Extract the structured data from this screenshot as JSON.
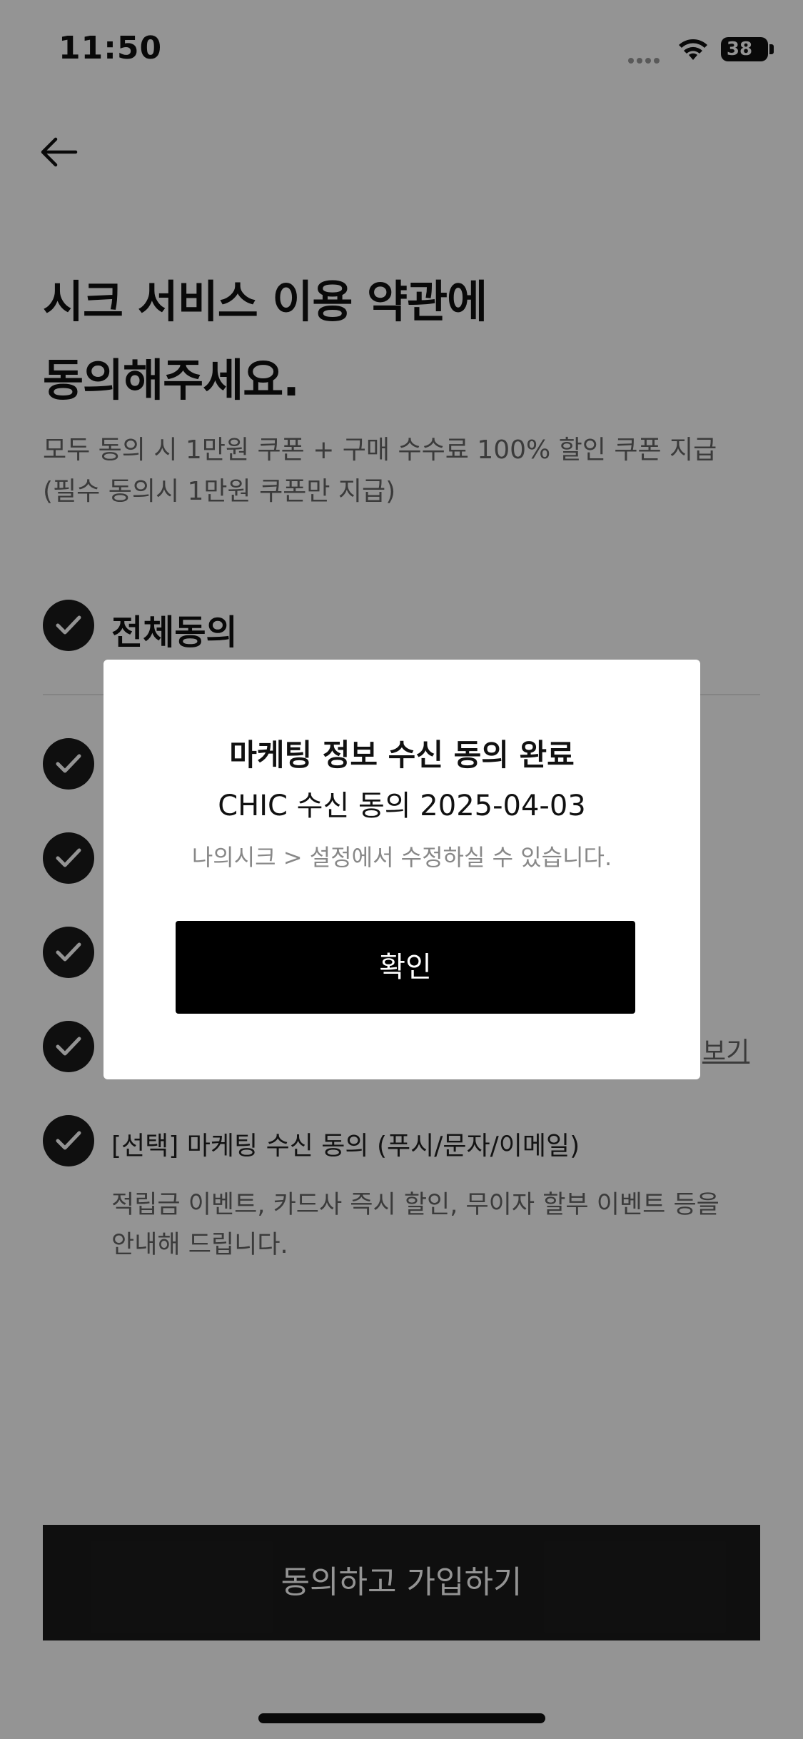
{
  "status_bar": {
    "time": "11:50",
    "battery": "38"
  },
  "header": {
    "back_icon": "arrow-left-icon"
  },
  "title_lines": [
    "시크 서비스 이용 약관에",
    "동의해주세요."
  ],
  "subtitle_lines": [
    "모두 동의 시 1만원 쿠폰 + 구매 수수료 100% 할인 쿠폰 지급",
    "(필수 동의시 1만원 쿠폰만 지급)"
  ],
  "agree_all_label": "전체동의",
  "agreements": {
    "view_link": "보기",
    "marketing_label": "[선택] 마케팅 수신 동의 (푸시/문자/이메일)",
    "marketing_desc_lines": [
      "적립금 이벤트, 카드사 즉시 할인, 무이자 할부 이벤트 등을",
      "안내해 드립니다."
    ]
  },
  "cta_label": "동의하고 가입하기",
  "modal": {
    "title": "마케팅 정보 수신 동의 완료",
    "line": "CHIC 수신 동의 2025-04-03",
    "note": "나의시크 > 설정에서 수정하실 수 있습니다.",
    "confirm_label": "확인"
  },
  "colors": {
    "check_fill": "#1b1b1b",
    "cta_bg": "#1b1b1b",
    "overlay": "rgba(0,0,0,0.42)"
  }
}
